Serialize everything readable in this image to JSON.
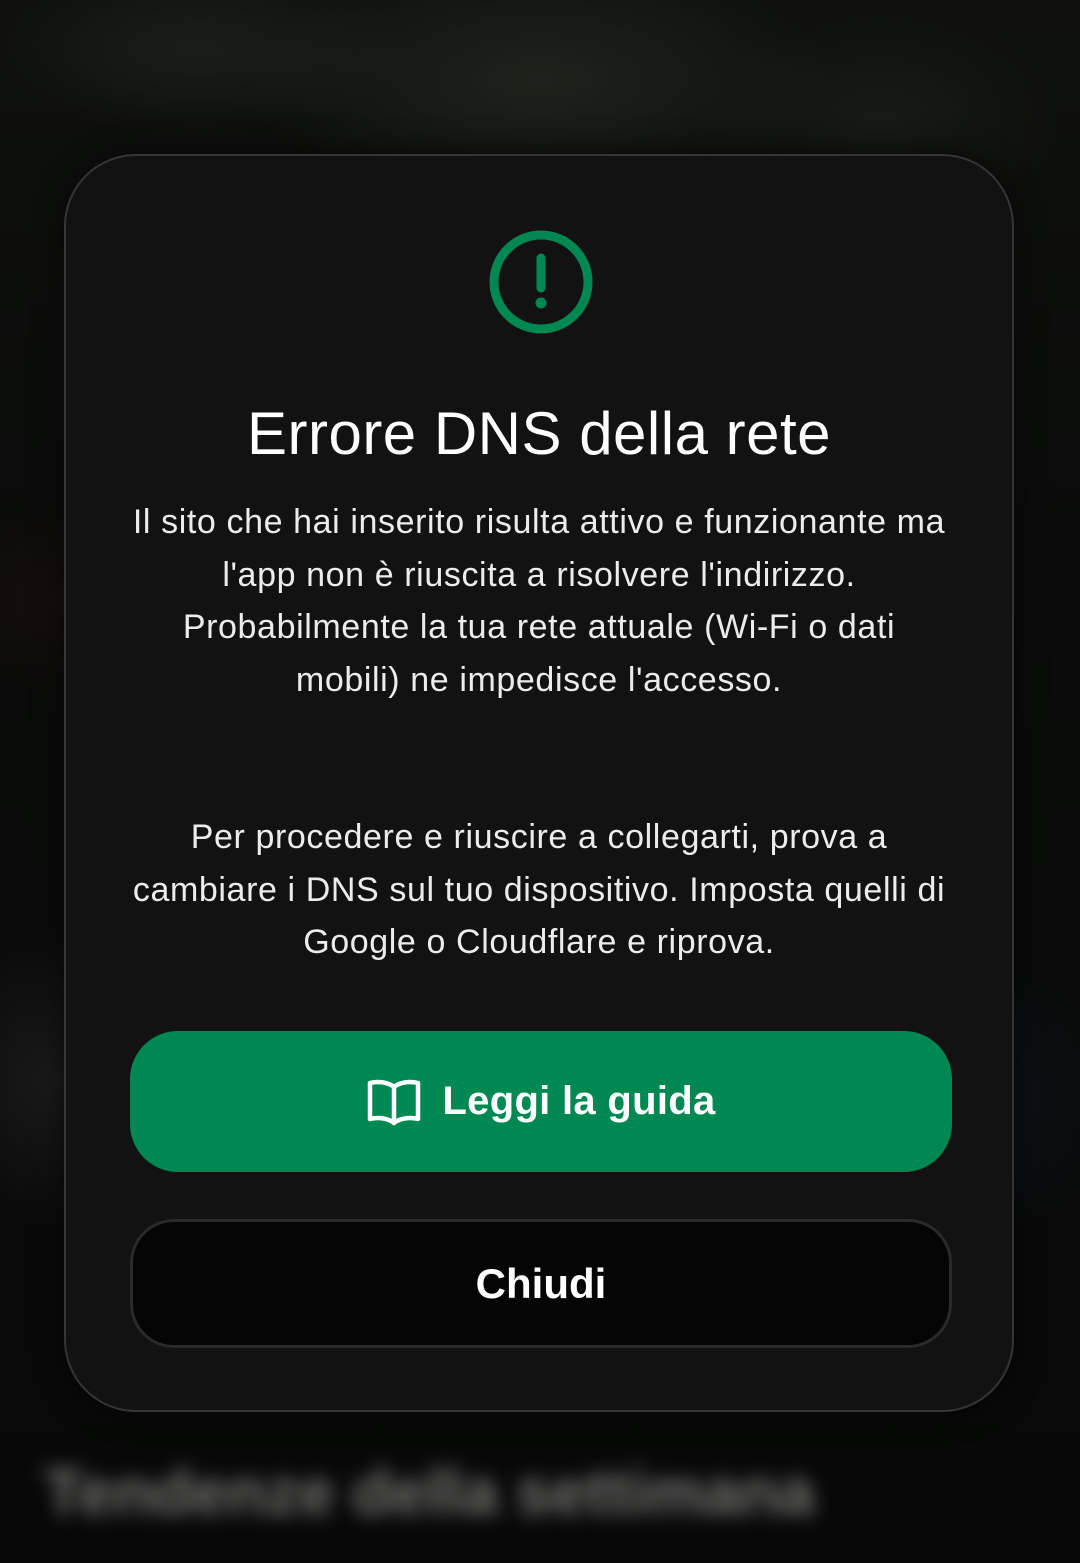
{
  "background": {
    "section_heading": "Tendenze della settimana"
  },
  "dialog": {
    "icon": "alert-circle-icon",
    "title": "Errore DNS della rete",
    "paragraph_1": "Il sito che hai inserito risulta attivo e funzionante ma l'app non è riuscita a risolvere l'indirizzo. Probabilmente la tua rete attuale (Wi-Fi o dati mobili) ne impedisce l'accesso.",
    "paragraph_2": "Per procedere e riuscire a collegarti, prova a cambiare i DNS sul tuo dispositivo. Imposta quelli di Google o Cloudflare e riprova.",
    "primary_button": {
      "icon": "book-open-icon",
      "label": "Leggi la guida"
    },
    "secondary_button": {
      "label": "Chiudi"
    }
  },
  "colors": {
    "accent": "#008852",
    "dialog_background": "#121212",
    "text": "#ffffff"
  }
}
